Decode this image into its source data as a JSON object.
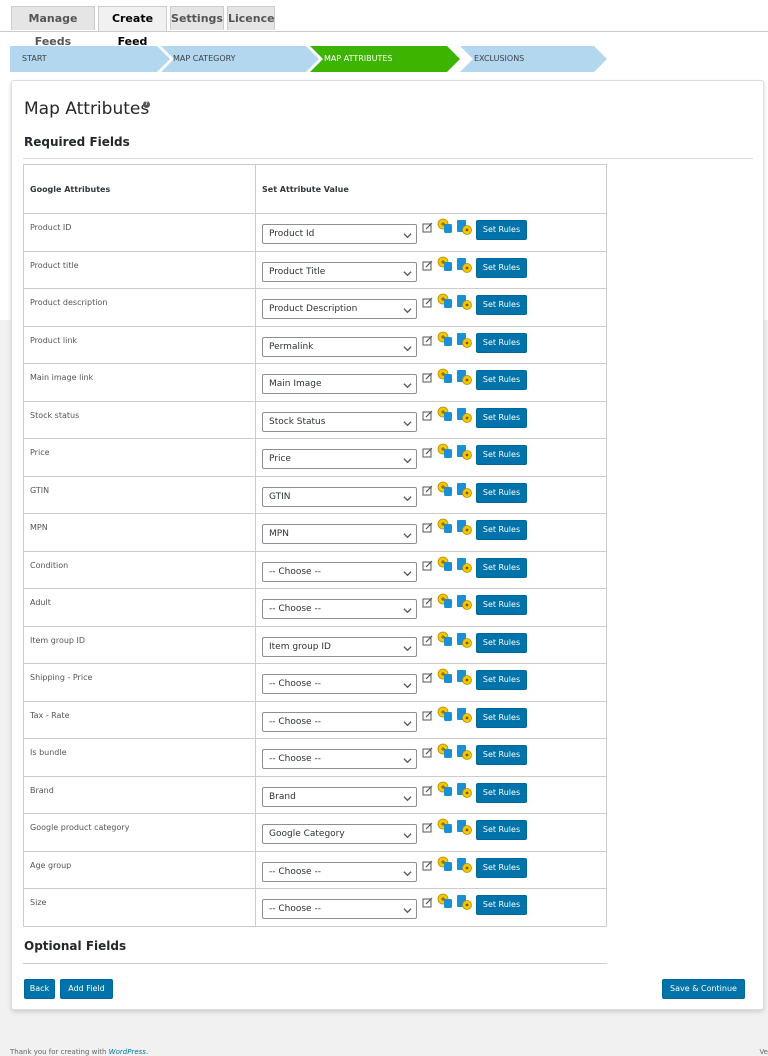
{
  "tabs": [
    "Manage Feeds",
    "Create Feed",
    "Settings",
    "Licence"
  ],
  "active_tab": "Create Feed",
  "steps": [
    {
      "label": "START",
      "active": false
    },
    {
      "label": "MAP CATEGORY",
      "active": false
    },
    {
      "label": "MAP ATTRIBUTES",
      "active": true
    },
    {
      "label": "EXCLUSIONS",
      "active": false
    }
  ],
  "colors": {
    "step_active": "#3db400",
    "step_inactive": "#b3d7ee",
    "button": "#0073aa"
  },
  "page": {
    "title": "Map Attributes",
    "help_icon": "?",
    "required_heading": "Required Fields",
    "optional_heading": "Optional Fields"
  },
  "table": {
    "headers": [
      "Google Attributes",
      "Set Attribute Value"
    ],
    "rows": [
      {
        "attribute": "Product ID",
        "value": "Product Id"
      },
      {
        "attribute": "Product title",
        "value": "Product Title"
      },
      {
        "attribute": "Product description",
        "value": "Product Description"
      },
      {
        "attribute": "Product link",
        "value": "Permalink"
      },
      {
        "attribute": "Main image link",
        "value": "Main Image"
      },
      {
        "attribute": "Stock status",
        "value": "Stock Status"
      },
      {
        "attribute": "Price",
        "value": "Price"
      },
      {
        "attribute": "GTIN",
        "value": "GTIN"
      },
      {
        "attribute": "MPN",
        "value": "MPN"
      },
      {
        "attribute": "Condition",
        "value": "-- Choose --"
      },
      {
        "attribute": "Adult",
        "value": "-- Choose --"
      },
      {
        "attribute": "Item group ID",
        "value": "Item group ID"
      },
      {
        "attribute": "Shipping - Price",
        "value": "-- Choose --"
      },
      {
        "attribute": "Tax - Rate",
        "value": "-- Choose --"
      },
      {
        "attribute": "Is bundle",
        "value": "-- Choose --"
      },
      {
        "attribute": "Brand",
        "value": "Brand"
      },
      {
        "attribute": "Google product category",
        "value": "Google Category"
      },
      {
        "attribute": "Age group",
        "value": "-- Choose --"
      },
      {
        "attribute": "Size",
        "value": "-- Choose --"
      }
    ],
    "set_rules_label": "Set Rules",
    "row_icons": [
      "edit-icon",
      "static-value-icon",
      "conditional-value-icon"
    ]
  },
  "buttons": {
    "back": "Back",
    "add_field": "Add Field",
    "save": "Save & Continue"
  },
  "footer": {
    "prefix": "Thank you for creating with",
    "link": "WordPress",
    "suffix": ".",
    "version": "Ve"
  }
}
